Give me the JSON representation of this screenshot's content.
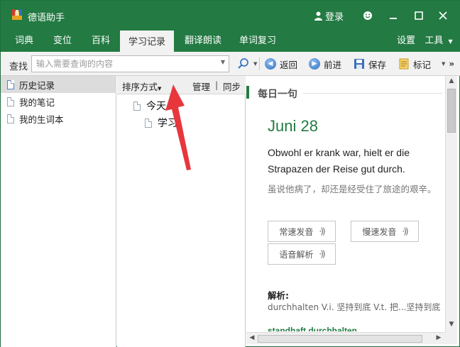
{
  "app": {
    "title": "德语助手",
    "login_label": "登录"
  },
  "menu": {
    "items": [
      "词典",
      "变位",
      "百科",
      "学习记录",
      "翻译朗读",
      "单词复习"
    ],
    "active": "学习记录",
    "settings_label": "设置",
    "tools_label": "工具"
  },
  "toolbar": {
    "search_label": "查找",
    "search_placeholder": "输入需要查询的内容",
    "back_label": "返回",
    "forward_label": "前进",
    "save_label": "保存",
    "bookmark_label": "标记"
  },
  "sidebar": {
    "items": [
      {
        "label": "历史记录",
        "selected": true
      },
      {
        "label": "我的笔记",
        "selected": false
      },
      {
        "label": "我的生词本",
        "selected": false
      }
    ]
  },
  "history": {
    "sort_label": "排序方式",
    "manage_label": "管理",
    "sync_label": "同步",
    "tree": [
      {
        "label": "今天",
        "level": 0
      },
      {
        "label": "学习",
        "level": 1
      }
    ]
  },
  "daily": {
    "section_title": "每日一句",
    "date": "Juni 28",
    "sentence_de": "Obwohl er krank war, hielt er die Strapazen der Reise gut durch.",
    "sentence_zh": "虽说他病了，却还是经受住了旅途的艰辛。",
    "normal_speed_label": "常速发音",
    "slow_speed_label": "慢速发音",
    "analysis_button_label": "语音解析",
    "analysis_label": "解析:",
    "analysis_text": "durchhalten V.i. 坚持到底 V.t. 把...坚持到底",
    "related_words": "standhaft durchhalten"
  },
  "colors": {
    "brand": "#237a43",
    "annotation_arrow": "#e8363d"
  }
}
